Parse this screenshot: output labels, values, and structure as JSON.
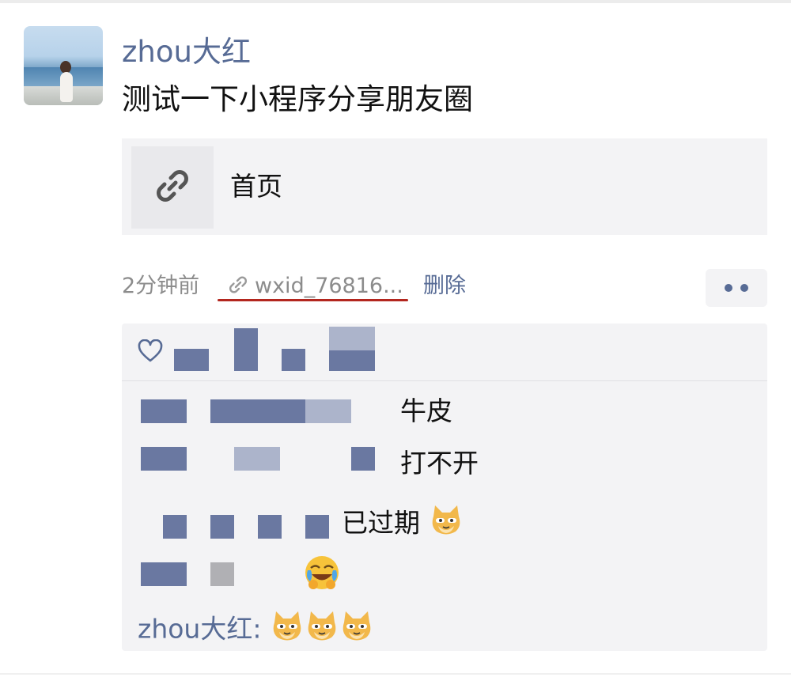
{
  "post": {
    "username": "zhou大红",
    "text": "测试一下小程序分享朋友圈",
    "share_title": "首页",
    "time": "2分钟前",
    "source": "wxid_76816...",
    "delete_label": "删除"
  },
  "comments": [
    {
      "text": "牛皮"
    },
    {
      "text": "打不开"
    },
    {
      "text": "已过期"
    }
  ],
  "last_comment": {
    "commenter": "zhou大红:"
  },
  "icons": {
    "share": "link-icon",
    "source": "link-icon",
    "like": "heart-icon",
    "more": "more-dots-icon"
  },
  "colors": {
    "name": "#576b95",
    "text": "#111111",
    "meta": "#8c8c8c",
    "card_bg": "#f3f3f5",
    "annotation": "#b3261e"
  }
}
